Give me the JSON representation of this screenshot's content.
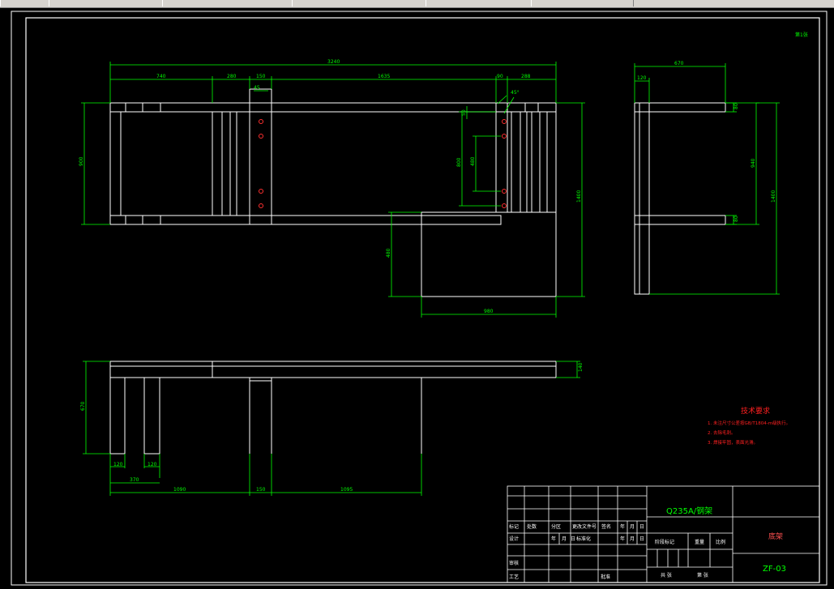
{
  "app": {
    "toolbar_tabs": [
      "",
      "",
      "",
      "",
      "",
      ""
    ]
  },
  "drawing": {
    "corner_mark": "第1张",
    "front_dims": {
      "overall_width": "3240",
      "seg_740": "740",
      "seg_280": "280",
      "seg_150": "150",
      "seg_1635": "1635",
      "seg_90": "90",
      "seg_288": "288",
      "hole_45": "45",
      "angle_45": "45°",
      "height_900": "900",
      "height_1400": "1400",
      "holes_800": "800",
      "holes_480": "480",
      "small_50": "50",
      "lower_480": "480",
      "lower_width_980": "980"
    },
    "side_dims": {
      "width_670": "670",
      "seg_120": "120",
      "small_top_80": "80",
      "small_bottom_80": "80",
      "height_940": "940",
      "height_1400": "1400"
    },
    "bottom_dims": {
      "thickness_140": "140",
      "height_670": "670",
      "leg1_120": "120",
      "leg2_120": "120",
      "span_370": "370",
      "seg_1090": "1090",
      "seg_150": "150",
      "seg_1095": "1095"
    },
    "tech": {
      "title": "技术要求",
      "lines": [
        "1. 未注尺寸公差按GB/T1804-m级执行。",
        "2. 去除毛刺。",
        "3. 焊接牢固，表面光滑。"
      ]
    },
    "title_block": {
      "material": "Q235A/钢架",
      "part_name": "底架",
      "drawing_no": "ZF-03",
      "row_marks": [
        "标记",
        "处数",
        "分区",
        "更改文件号",
        "签名",
        "年",
        "月",
        "日"
      ],
      "design_row": [
        "设计",
        "",
        "",
        "年",
        "月",
        "日",
        "标准化",
        "",
        "",
        "年",
        "月",
        "日"
      ],
      "check_label": "审核",
      "process_label": "工艺",
      "approve_label": "批准",
      "stage_label": "阶段标记",
      "weight_label": "重量",
      "scale_label": "比例",
      "sheets_total": "共  张",
      "sheet_no": "第  张"
    }
  }
}
